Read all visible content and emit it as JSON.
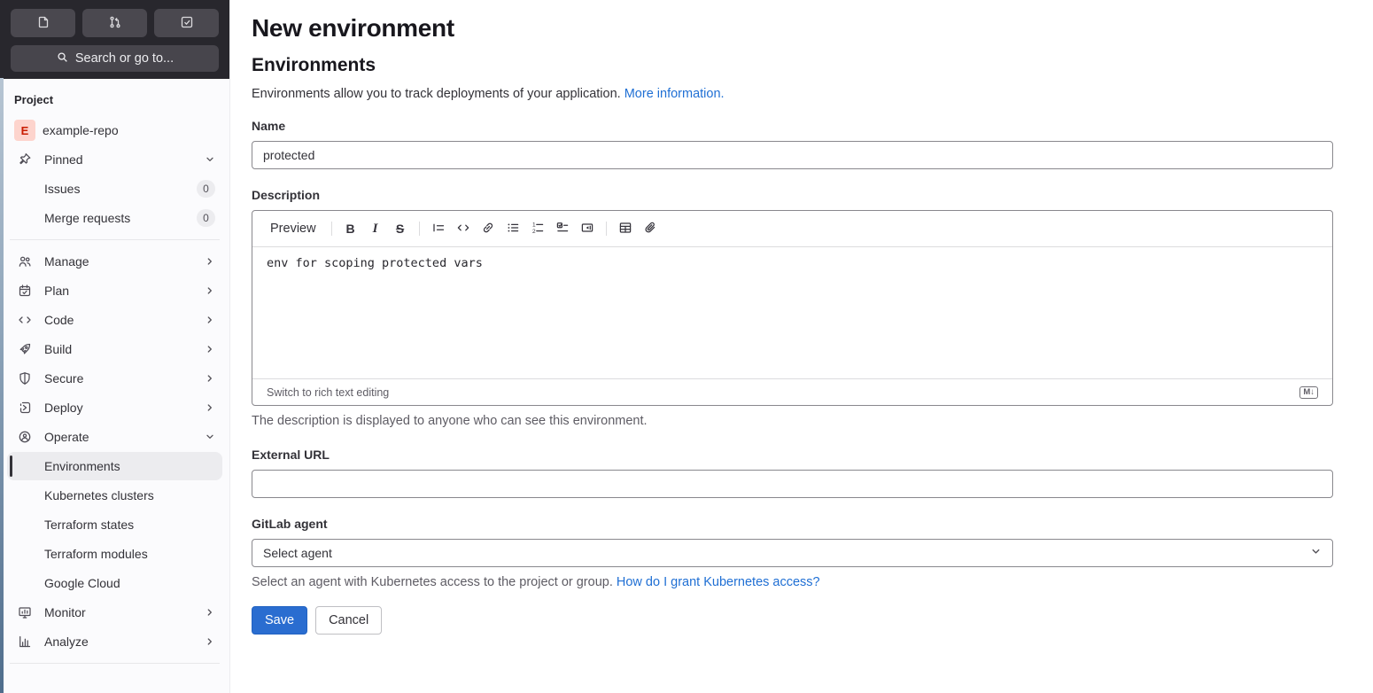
{
  "topbar": {
    "search_label": "Search or go to...",
    "icons": [
      "issues-icon",
      "merge-request-icon",
      "todo-list-icon"
    ]
  },
  "sidebar": {
    "section_label": "Project",
    "project_avatar_letter": "E",
    "project_name": "example-repo",
    "pinned_label": "Pinned",
    "pinned_items": [
      {
        "label": "Issues",
        "badge": "0"
      },
      {
        "label": "Merge requests",
        "badge": "0"
      }
    ],
    "menu": [
      {
        "label": "Manage",
        "icon": "users-icon"
      },
      {
        "label": "Plan",
        "icon": "calendar-icon"
      },
      {
        "label": "Code",
        "icon": "code-icon"
      },
      {
        "label": "Build",
        "icon": "rocket-icon"
      },
      {
        "label": "Secure",
        "icon": "shield-icon"
      },
      {
        "label": "Deploy",
        "icon": "deploy-icon"
      },
      {
        "label": "Operate",
        "icon": "globe-icon"
      },
      {
        "label": "Monitor",
        "icon": "monitor-icon"
      },
      {
        "label": "Analyze",
        "icon": "chart-icon"
      }
    ],
    "operate_children": [
      {
        "label": "Environments",
        "active": true
      },
      {
        "label": "Kubernetes clusters"
      },
      {
        "label": "Terraform states"
      },
      {
        "label": "Terraform modules"
      },
      {
        "label": "Google Cloud"
      }
    ]
  },
  "main": {
    "title": "New environment",
    "section_heading": "Environments",
    "intro_text": "Environments allow you to track deployments of your application.",
    "intro_link": "More information.",
    "name": {
      "label": "Name",
      "value": "protected"
    },
    "description": {
      "label": "Description",
      "preview_tab": "Preview",
      "toolbar_icons": [
        "bold",
        "italic",
        "strikethrough",
        "quote",
        "code",
        "link",
        "bullet-list",
        "numbered-list",
        "task-list",
        "collapsible-section",
        "table",
        "attach-file"
      ],
      "value": "env for scoping protected vars",
      "switch_link": "Switch to rich text editing",
      "markdown_badge": "M↓",
      "help": "The description is displayed to anyone who can see this environment."
    },
    "external_url": {
      "label": "External URL",
      "value": ""
    },
    "agent": {
      "label": "GitLab agent",
      "selected": "Select agent",
      "help": "Select an agent with Kubernetes access to the project or group.",
      "help_link": "How do I grant Kubernetes access?"
    },
    "actions": {
      "save": "Save",
      "cancel": "Cancel"
    }
  },
  "colors": {
    "accent_blue": "#2a6dd0",
    "link_blue": "#1f6fd4",
    "topbar_bg": "#28272d",
    "topbar_button_bg": "#4a484f",
    "sidebar_bg": "#fbfbfd",
    "active_item_bg": "#ececef",
    "active_indicator": "#333238",
    "input_border": "#89888d",
    "divider": "#dcdcde",
    "text_primary": "#28272d",
    "text_secondary": "#5e5c64",
    "avatar_bg": "#fdd4cd",
    "avatar_text": "#c91c00"
  }
}
